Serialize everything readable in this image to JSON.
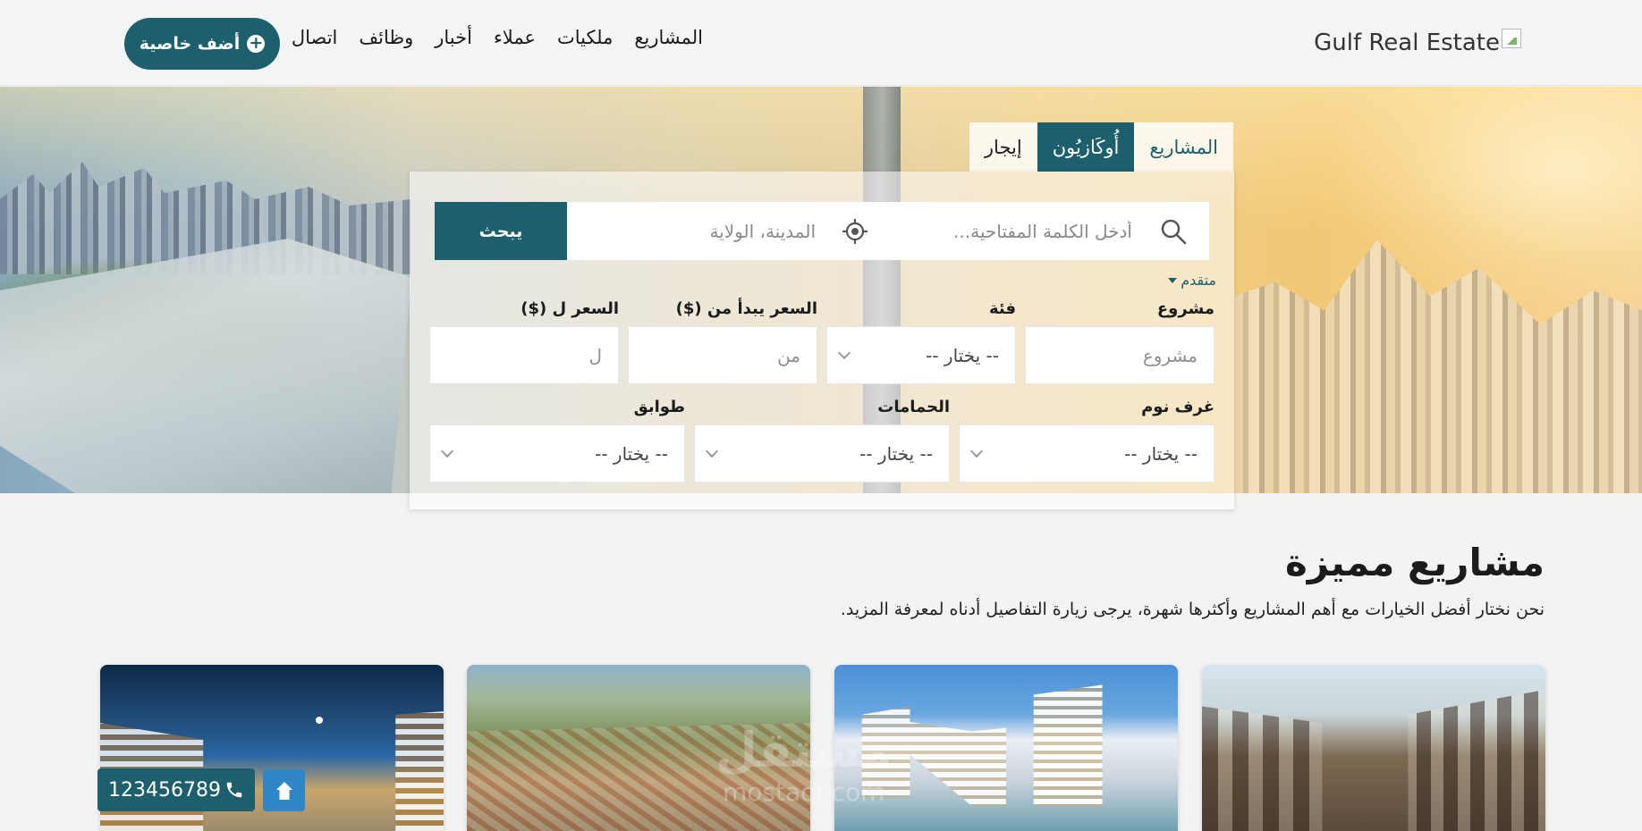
{
  "brand": {
    "name": "Gulf Real Estate"
  },
  "nav": {
    "items": [
      {
        "label": "المشاريع"
      },
      {
        "label": "ملكيات"
      },
      {
        "label": "عملاء"
      },
      {
        "label": "أخبار"
      },
      {
        "label": "وظائف"
      },
      {
        "label": "اتصال"
      }
    ],
    "add_property": "أضف خاصية"
  },
  "search": {
    "tabs": [
      "المشاريع",
      "أُوكَازيُون",
      "إيجار"
    ],
    "active_tab": "أُوكَازيُون",
    "keyword_placeholder": "أدخل الكلمة المفتاحية...",
    "location_placeholder": "المدينة، الولاية",
    "submit": "يبحث",
    "advanced": "متقدم",
    "labels": {
      "project": "مشروع",
      "category": "فئة",
      "price_from": "السعر يبدأ من ($)",
      "price_to": "السعر ل ($)",
      "bedrooms": "غرف نوم",
      "bathrooms": "الحمامات",
      "floors": "طوابق"
    },
    "values": {
      "project_placeholder": "مشروع",
      "category": "-- يختار --",
      "price_from_placeholder": "من",
      "price_to_placeholder": "ل",
      "bedrooms": "-- يختار --",
      "bathrooms": "-- يختار --",
      "floors": "-- يختار --"
    }
  },
  "featured": {
    "title": "مشاريع مميزة",
    "subtitle": "نحن نختار أفضل الخيارات مع أهم المشاريع وأكثرها شهرة، يرجى زيارة التفاصيل أدناه لمعرفة المزيد."
  },
  "watermark": {
    "text": "مستقل",
    "sub": "mostaql.com"
  },
  "contact": {
    "phone": "123456789"
  },
  "colors": {
    "primary": "#1d5f6c",
    "scroll_top": "#2f86c6"
  }
}
